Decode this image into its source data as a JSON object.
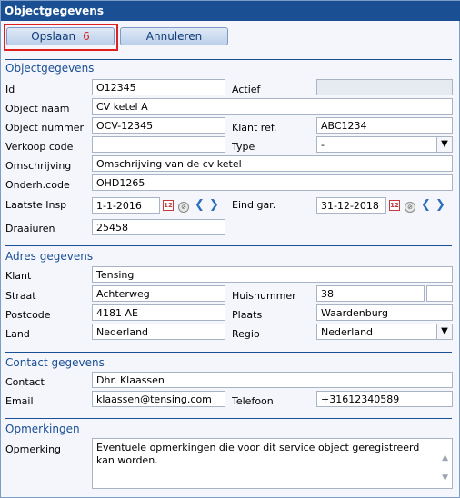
{
  "window": {
    "title": "Objectgegevens"
  },
  "toolbar": {
    "save_label": "Opslaan",
    "save_badge": "6",
    "cancel_label": "Annuleren"
  },
  "sections": {
    "object": "Objectgegevens",
    "address": "Adres gegevens",
    "contact": "Contact gegevens",
    "remarks": "Opmerkingen"
  },
  "object": {
    "id_label": "Id",
    "id_value": "O12345",
    "active_label": "Actief",
    "active_value": "",
    "name_label": "Object naam",
    "name_value": "CV ketel A",
    "number_label": "Object nummer",
    "number_value": "OCV-12345",
    "clientref_label": "Klant ref.",
    "clientref_value": "ABC1234",
    "salescode_label": "Verkoop code",
    "salescode_value": "",
    "type_label": "Type",
    "type_value": "-",
    "description_label": "Omschrijving",
    "description_value": "Omschrijving van de cv ketel",
    "maintcode_label": "Onderh.code",
    "maintcode_value": "OHD1265",
    "lastinsp_label": "Laatste Insp",
    "lastinsp_value": "1-1-2016",
    "warranty_label": "Eind gar.",
    "warranty_value": "31-12-2018",
    "hours_label": "Draaiuren",
    "hours_value": "25458"
  },
  "address": {
    "client_label": "Klant",
    "client_value": "Tensing",
    "street_label": "Straat",
    "street_value": "Achterweg",
    "housenr_label": "Huisnummer",
    "housenr_value": "38",
    "housenr_suffix": "",
    "postcode_label": "Postcode",
    "postcode_value": "4181 AE",
    "city_label": "Plaats",
    "city_value": "Waardenburg",
    "country_label": "Land",
    "country_value": "Nederland",
    "region_label": "Regio",
    "region_value": "Nederland"
  },
  "contact": {
    "contact_label": "Contact",
    "contact_value": "Dhr. Klaassen",
    "email_label": "Email",
    "email_value": "klaassen@tensing.com",
    "phone_label": "Telefoon",
    "phone_value": "+31612340589"
  },
  "remarks": {
    "remark_label": "Opmerking",
    "remark_value": "Eventuele opmerkingen die voor dit service object geregistreerd kan worden."
  },
  "icons": {
    "calendar": "calendar-icon",
    "clear": "clear-icon",
    "prev": "chevron-left-icon",
    "next": "chevron-right-icon",
    "dropdown": "chevron-down-icon"
  },
  "colors": {
    "header": "#1a4f94",
    "highlight": "#e02020",
    "accent": "#1a4f94"
  }
}
